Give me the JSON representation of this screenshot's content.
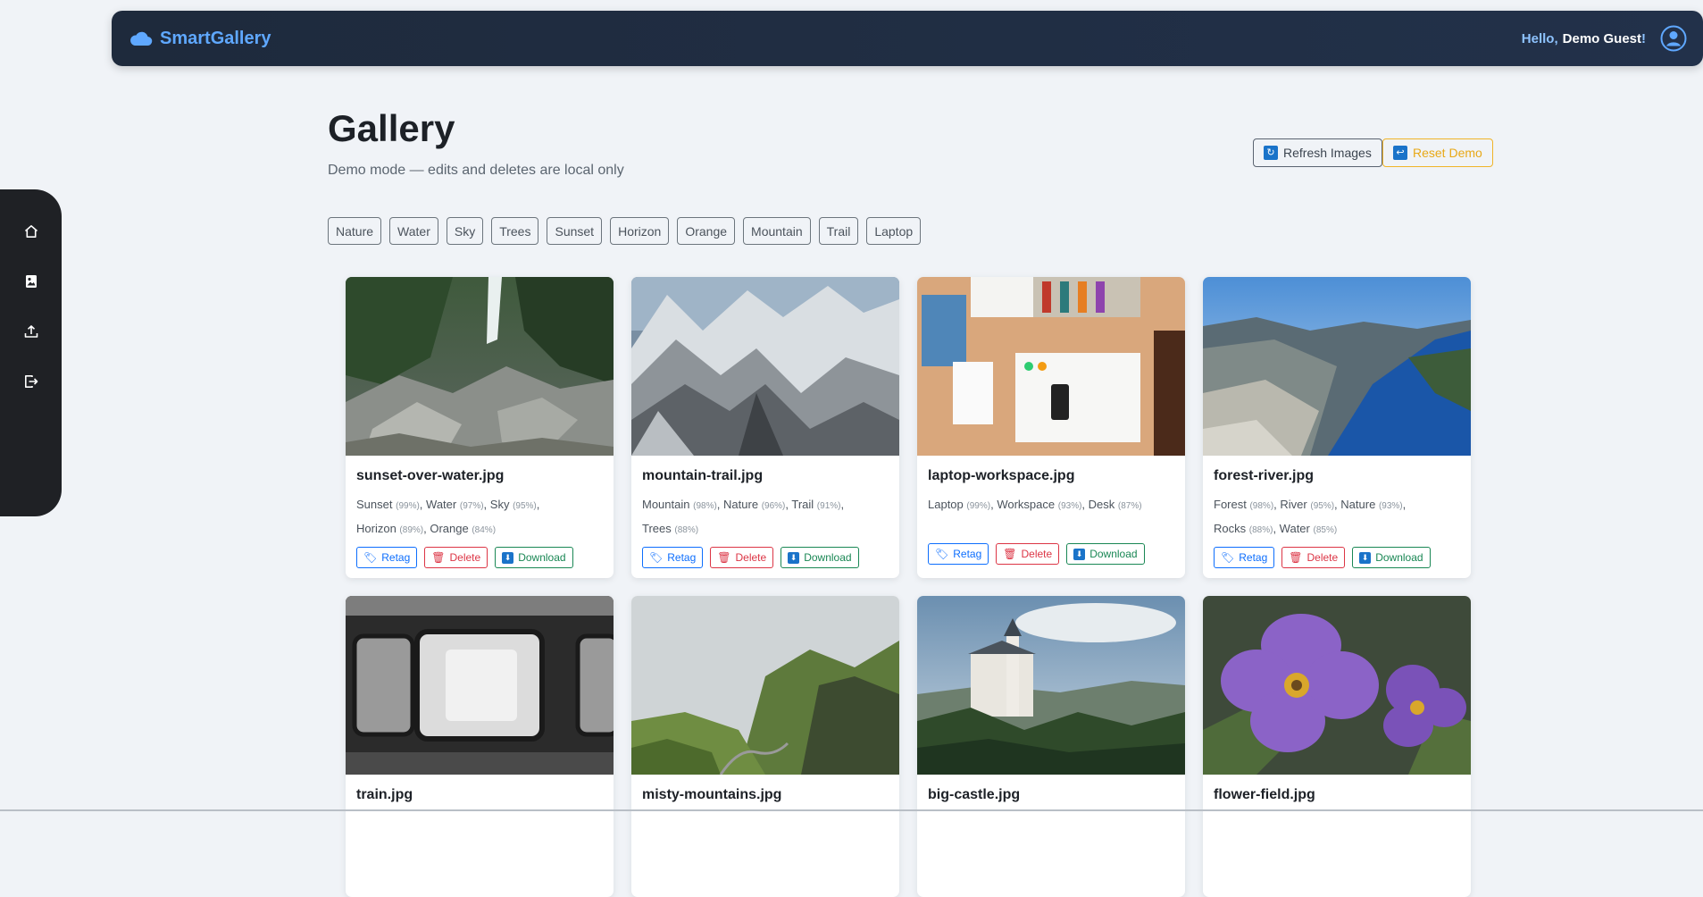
{
  "navbar": {
    "brand": "SmartGallery",
    "greeting_prefix": "Hello,",
    "user_name": "Demo Guest",
    "greeting_suffix": "!"
  },
  "sidebar": {
    "items": [
      {
        "icon": "home-icon"
      },
      {
        "icon": "gallery-icon"
      },
      {
        "icon": "upload-icon"
      },
      {
        "icon": "logout-icon"
      }
    ]
  },
  "header": {
    "title": "Gallery",
    "subtitle": "Demo mode — edits and deletes are local only",
    "refresh_label": "Refresh Images",
    "reset_label": "Reset Demo"
  },
  "tag_filters": [
    "Nature",
    "Water",
    "Sky",
    "Trees",
    "Sunset",
    "Horizon",
    "Orange",
    "Mountain",
    "Trail",
    "Laptop"
  ],
  "actions": {
    "retag": "Retag",
    "delete": "Delete",
    "download": "Download"
  },
  "colors": {
    "navbar": "#1e2a3c",
    "brand": "#5fa8ff",
    "sidebar": "#1f2125",
    "retag": "#0d6efd",
    "delete": "#dc3545",
    "download": "#198754",
    "reset": "#f0b429"
  },
  "images": [
    {
      "filename": "sunset-over-water.jpg",
      "tags": [
        {
          "name": "Sunset",
          "conf": "(99%)"
        },
        {
          "name": "Water",
          "conf": "(97%)"
        },
        {
          "name": "Sky",
          "conf": "(95%)"
        },
        {
          "name": "Horizon",
          "conf": "(89%)"
        },
        {
          "name": "Orange",
          "conf": "(84%)"
        }
      ]
    },
    {
      "filename": "mountain-trail.jpg",
      "tags": [
        {
          "name": "Mountain",
          "conf": "(98%)"
        },
        {
          "name": "Nature",
          "conf": "(96%)"
        },
        {
          "name": "Trail",
          "conf": "(91%)"
        },
        {
          "name": "Trees",
          "conf": "(88%)"
        }
      ]
    },
    {
      "filename": "laptop-workspace.jpg",
      "tags": [
        {
          "name": "Laptop",
          "conf": "(99%)"
        },
        {
          "name": "Workspace",
          "conf": "(93%)"
        },
        {
          "name": "Desk",
          "conf": "(87%)"
        }
      ]
    },
    {
      "filename": "forest-river.jpg",
      "tags": [
        {
          "name": "Forest",
          "conf": "(98%)"
        },
        {
          "name": "River",
          "conf": "(95%)"
        },
        {
          "name": "Nature",
          "conf": "(93%)"
        },
        {
          "name": "Rocks",
          "conf": "(88%)"
        },
        {
          "name": "Water",
          "conf": "(85%)"
        }
      ]
    },
    {
      "filename": "train.jpg",
      "tags": []
    },
    {
      "filename": "misty-mountains.jpg",
      "tags": []
    },
    {
      "filename": "big-castle.jpg",
      "tags": []
    },
    {
      "filename": "flower-field.jpg",
      "tags": []
    }
  ]
}
